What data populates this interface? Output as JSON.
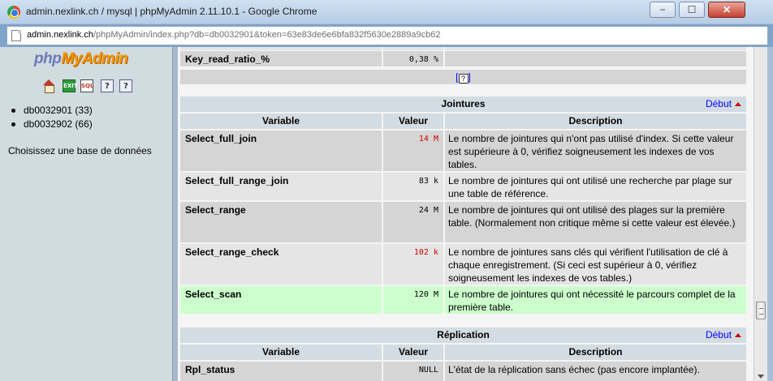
{
  "window": {
    "title": "admin.nexlink.ch / mysql | phpMyAdmin 2.11.10.1 - Google Chrome",
    "minimize": "−",
    "maximize": "☐",
    "close": "✕"
  },
  "address": {
    "host": "admin.nexlink.ch",
    "rest": "/phpMyAdmin/index.php?db=db0032901&token=63e83de6e6bfa832f5630e2889a9cb62"
  },
  "sidebar": {
    "logo": {
      "php": "php",
      "my": "My",
      "admin": "Admin"
    },
    "icons": {
      "exit": "EXIT",
      "sql": "SQL",
      "help": "?"
    },
    "databases": [
      "db0032901 (33)",
      "db0032902 (66)"
    ],
    "choose_label": "Choisissez une base de données"
  },
  "top_row": {
    "name": "Key_read_ratio_%",
    "value": "0,38 %",
    "help_prefix": "[",
    "help_icon": "?",
    "help_suffix": "]"
  },
  "colors": {
    "section_header": "#d3dce3",
    "row_even": "#d5d5d5",
    "row_odd": "#e5e5e5",
    "row_highlight": "#ccffcc",
    "link": "#0000ff",
    "alert_value": "#cc0000"
  },
  "sections": [
    {
      "title": "Jointures",
      "link": "Début",
      "columns": [
        "Variable",
        "Valeur",
        "Description"
      ],
      "rows": [
        {
          "name": "Select_full_join",
          "value": "14 M",
          "alert": true,
          "desc": "Le nombre de jointures qui n'ont pas utilisé d'index. Si cette valeur est supérieure à 0, vérifiez soigneusement les indexes de vos tables."
        },
        {
          "name": "Select_full_range_join",
          "value": "83 k",
          "alert": false,
          "desc": "Le nombre de jointures qui ont utilisé une recherche par plage sur une table de référence."
        },
        {
          "name": "Select_range",
          "value": "24 M",
          "alert": false,
          "desc": "Le nombre de jointures qui ont utilisé des plages sur la première table. (Normalement non critique même si cette valeur est élevée.)"
        },
        {
          "name": "Select_range_check",
          "value": "102 k",
          "alert": true,
          "desc": "Le nombre de jointures sans clés qui vérifient l'utilisation de clé à chaque enregistrement. (Si ceci est supérieur à 0, vérifiez soigneusement les indexes de vos tables.)"
        },
        {
          "name": "Select_scan",
          "value": "120 M",
          "alert": false,
          "desc": "Le nombre de jointures qui ont nécessité le parcours complet de la première table."
        }
      ]
    },
    {
      "title": "Réplication",
      "link": "Début",
      "columns": [
        "Variable",
        "Valeur",
        "Description"
      ],
      "rows": [
        {
          "name": "Rpl_status",
          "value": "NULL",
          "alert": false,
          "desc": "L'état de la réplication sans échec (pas encore implantée)."
        }
      ]
    }
  ]
}
